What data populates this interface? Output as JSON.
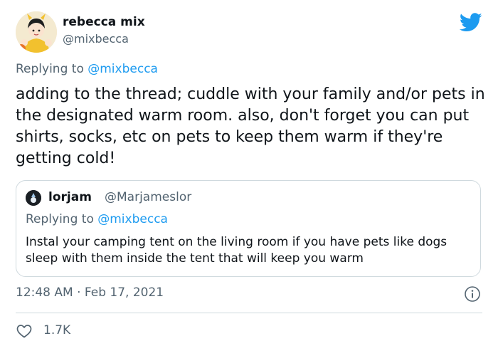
{
  "author": {
    "display_name": "rebecca mix",
    "handle": "@mixbecca",
    "avatar_icon": "profile-avatar-illustration"
  },
  "replying": {
    "prefix": "Replying to ",
    "target": "@mixbecca"
  },
  "tweet": {
    "text": "adding to the thread; cuddle with your family and/or pets in the designated warm room. also, don't forget you can put shirts, socks, etc on pets to keep them warm if they're getting cold!"
  },
  "quoted": {
    "display_name": "lorjam",
    "handle": "@Marjameslor",
    "replying_prefix": "Replying to ",
    "replying_target": "@mixbecca",
    "text": "Instal your camping tent on the living room if you have pets like dogs sleep with them inside the tent that will keep you warm"
  },
  "meta": {
    "timestamp": "12:48 AM · Feb 17, 2021",
    "likes": "1.7K"
  },
  "colors": {
    "accent": "#1d9bf0",
    "secondary_text": "#536471",
    "border": "#cfd9de"
  },
  "icons": {
    "brand": "twitter-bird-icon",
    "info": "info-icon",
    "like": "heart-outline-icon"
  }
}
